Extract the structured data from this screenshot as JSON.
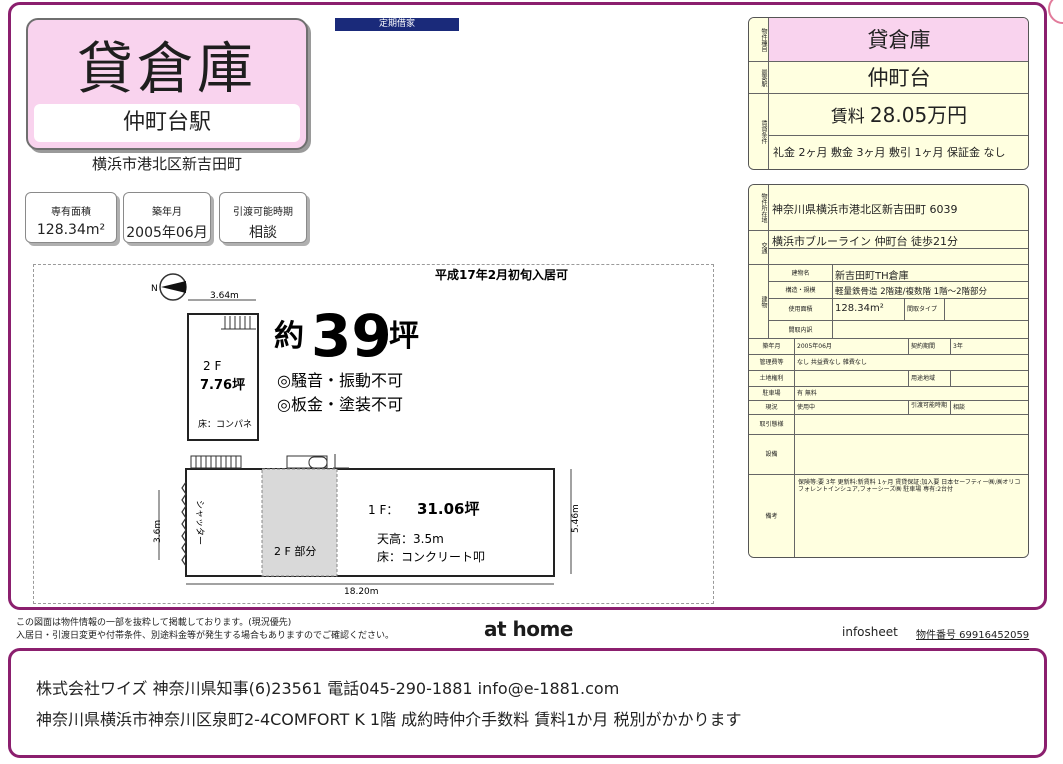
{
  "header": {
    "title": "貸倉庫",
    "station": "仲町台駅",
    "address": "横浜市港北区新吉田町",
    "teiki_badge": "定期借家"
  },
  "info_cards": [
    {
      "label": "専有面積",
      "value": "128.34m²"
    },
    {
      "label": "築年月",
      "value": "2005年06月"
    },
    {
      "label": "引渡可能時期",
      "value": "相談"
    }
  ],
  "floor_plan": {
    "date_note": "平成17年2月初旬入居可",
    "area_headline_prefix": "約",
    "area_headline_number": "39",
    "area_headline_unit": "坪",
    "restriction_1": "◎騒音・振動不可",
    "restriction_2": "◎板金・塗装不可",
    "floor2_label": "2 F",
    "floor2_area": "7.76坪",
    "floor2_floor": "床：コンパネ",
    "floor1_label": "1 F：",
    "floor1_area": "31.06坪",
    "ceiling": "天高：3.5m",
    "floor1_floor": "床：コンクリート叩",
    "part2f": "2 F 部分",
    "shutter": "シャッター",
    "dim_top": "3.64m",
    "dim_left": "3.6m",
    "dim_right": "5.46m",
    "dim_bottom": "18.20m",
    "north": "N"
  },
  "summary": {
    "type_label": "物件種目",
    "type_value": "貸倉庫",
    "station_label": "最寄駅",
    "station_value": "仲町台",
    "price_label": "賃貸条件",
    "rent_label": "賃料",
    "rent_value": "28.05万円",
    "conditions": "礼金 2ヶ月  敷金 3ヶ月  敷引 1ヶ月  保証金 なし"
  },
  "detail": {
    "location_label": "物件所在地",
    "location_value": "神奈川県横浜市港北区新吉田町 6039",
    "traffic_label": "交通",
    "traffic_value": "横浜市ブルーライン 仲町台 徒歩21分",
    "building_label": "建物",
    "name_label": "建物名",
    "name_value": "新吉田町TH倉庫",
    "structure_label": "構造・規模",
    "structure_value": "軽量鉄骨造 2階建/複数階 1階〜2階部分",
    "area_label": "使用面積",
    "area_value": "128.34m²",
    "layout_label": "間取タイプ",
    "layout_detail_label": "間取内訳",
    "built_label": "築年月",
    "built_value": "2005年06月",
    "term_label": "契約期間",
    "term_value": "3年",
    "mgmt_label": "管理費等",
    "mgmt_value": "なし  共益費なし  雑費なし",
    "land_label": "土地権利",
    "zone_label": "用途地域",
    "parking_label": "駐車場",
    "parking_value": "有  無料",
    "status_label": "現況",
    "status_value": "使用中",
    "handover_label": "引渡可能時期",
    "handover_value": "相談",
    "transaction_label": "取引態様",
    "equipment_label": "設備",
    "remarks_label": "備考",
    "remarks_value": "保険等:要 3年  更新料:新賃料 1ヶ月  賃貸保証:加入要 日本セーフティー㈱,㈱オリコフォレントインシュア,フォーシーズ㈱  駐車場 専有:2台付"
  },
  "footer": {
    "note_1": "この図面は物件情報の一部を抜粋して掲載しております。(現況優先)",
    "note_2": "入居日・引渡日変更や付帯条件、別途料金等が発生する場合もありますのでご確認ください。",
    "logo": "at home",
    "infosheet": "infosheet",
    "property_no": "物件番号  69916452059",
    "company_line1": "株式会社ワイズ  神奈川県知事(6)23561  電話045-290-1881  info@e-1881.com",
    "company_line2": "神奈川県横浜市神奈川区泉町2-4COMFORT K 1階  成約時仲介手数料  賃料1か月  税別がかかります"
  }
}
